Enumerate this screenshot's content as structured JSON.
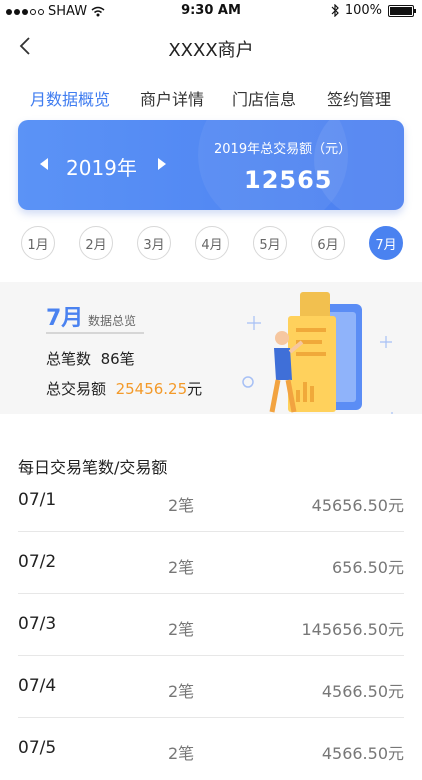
{
  "status_bar": {
    "carrier": "SHAW",
    "time": "9:30 AM",
    "battery": "100%"
  },
  "nav": {
    "title": "XXXX商户"
  },
  "tabs": [
    "月数据概览",
    "商户详情",
    "门店信息",
    "签约管理"
  ],
  "summary": {
    "year": "2019年",
    "total_label": "2019年总交易额（元）",
    "total_value": "12565"
  },
  "months": [
    "1月",
    "2月",
    "3月",
    "4月",
    "5月",
    "6月",
    "7月"
  ],
  "active_month_index": 6,
  "overview": {
    "month": "7月",
    "subtitle": "数据总览",
    "count_label": "总笔数",
    "count_value": "86笔",
    "amount_label": "总交易额",
    "amount_value": "25456.25",
    "amount_unit": "元"
  },
  "daily": {
    "title": "每日交易笔数/交易额",
    "rows": [
      {
        "date": "07/1",
        "count": "2笔",
        "amount": "45656.50元"
      },
      {
        "date": "07/2",
        "count": "2笔",
        "amount": "656.50元"
      },
      {
        "date": "07/3",
        "count": "2笔",
        "amount": "145656.50元"
      },
      {
        "date": "07/4",
        "count": "2笔",
        "amount": "4566.50元"
      },
      {
        "date": "07/5",
        "count": "2笔",
        "amount": "4566.50元"
      }
    ]
  },
  "icons": {
    "back": "chevron-left-icon",
    "wifi": "wifi-icon",
    "bluetooth": "bluetooth-icon",
    "battery": "battery-icon"
  },
  "colors": {
    "accent": "#4a82f0",
    "amount_highlight": "#f39a2a"
  }
}
